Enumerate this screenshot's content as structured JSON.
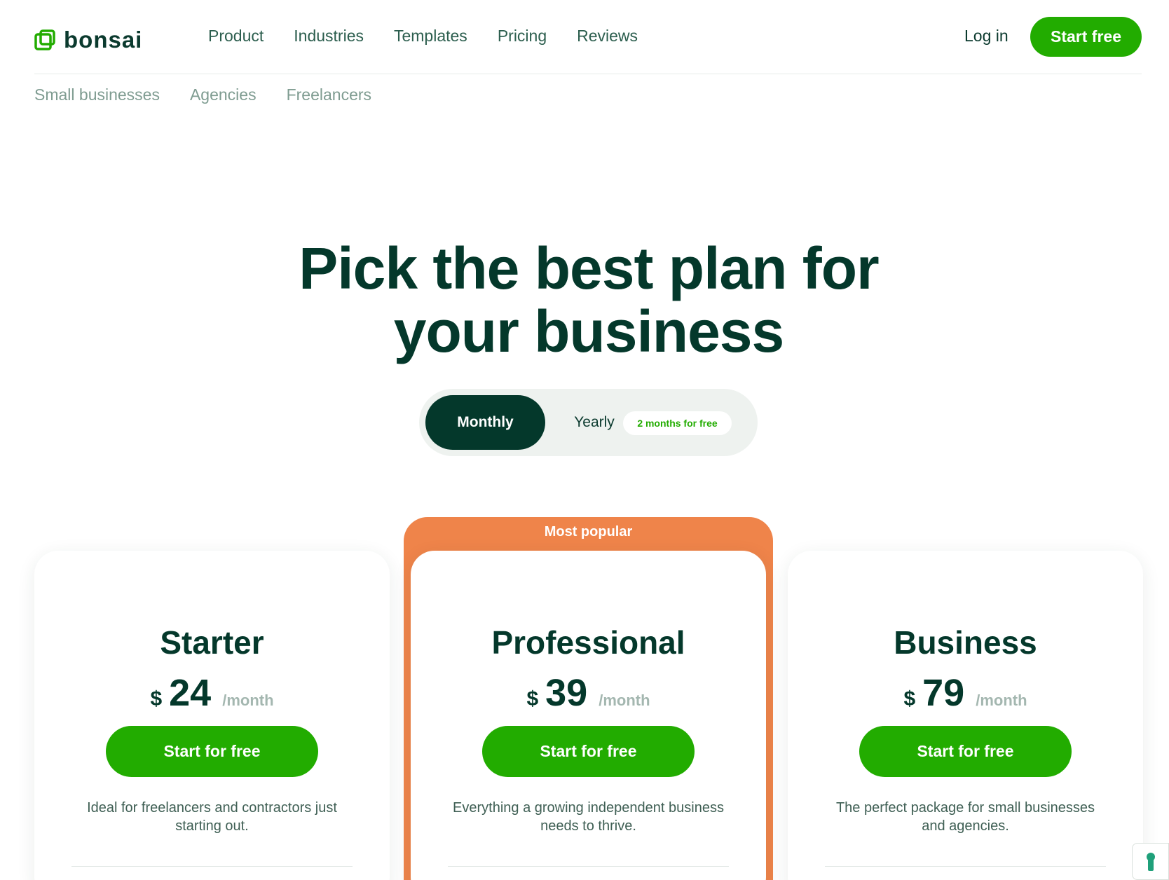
{
  "brand": {
    "name": "bonsai"
  },
  "nav": {
    "items": [
      "Product",
      "Industries",
      "Templates",
      "Pricing",
      "Reviews"
    ],
    "login": "Log in",
    "cta": "Start free"
  },
  "subnav": [
    "Small businesses",
    "Agencies",
    "Freelancers"
  ],
  "hero": {
    "title_line1": "Pick the best plan for",
    "title_line2": "your business"
  },
  "billing_toggle": {
    "monthly": "Monthly",
    "yearly": "Yearly",
    "badge": "2 months for free",
    "selected": "Monthly"
  },
  "popular_label": "Most popular",
  "plans": [
    {
      "name": "Starter",
      "currency": "$",
      "price": "24",
      "period": "/month",
      "cta": "Start for free",
      "description": "Ideal for freelancers and contractors just starting out."
    },
    {
      "name": "Professional",
      "currency": "$",
      "price": "39",
      "period": "/month",
      "cta": "Start for free",
      "description": "Everything a growing independent business needs to thrive."
    },
    {
      "name": "Business",
      "currency": "$",
      "price": "79",
      "period": "/month",
      "cta": "Start for free",
      "description": "The perfect package for small businesses and agencies."
    }
  ],
  "colors": {
    "brand_green": "#22ac00",
    "dark_green": "#04382b",
    "popular_orange": "#ef844a"
  },
  "icons": {
    "logo": "bonsai-logo-icon",
    "widget": "keyhole-icon"
  }
}
